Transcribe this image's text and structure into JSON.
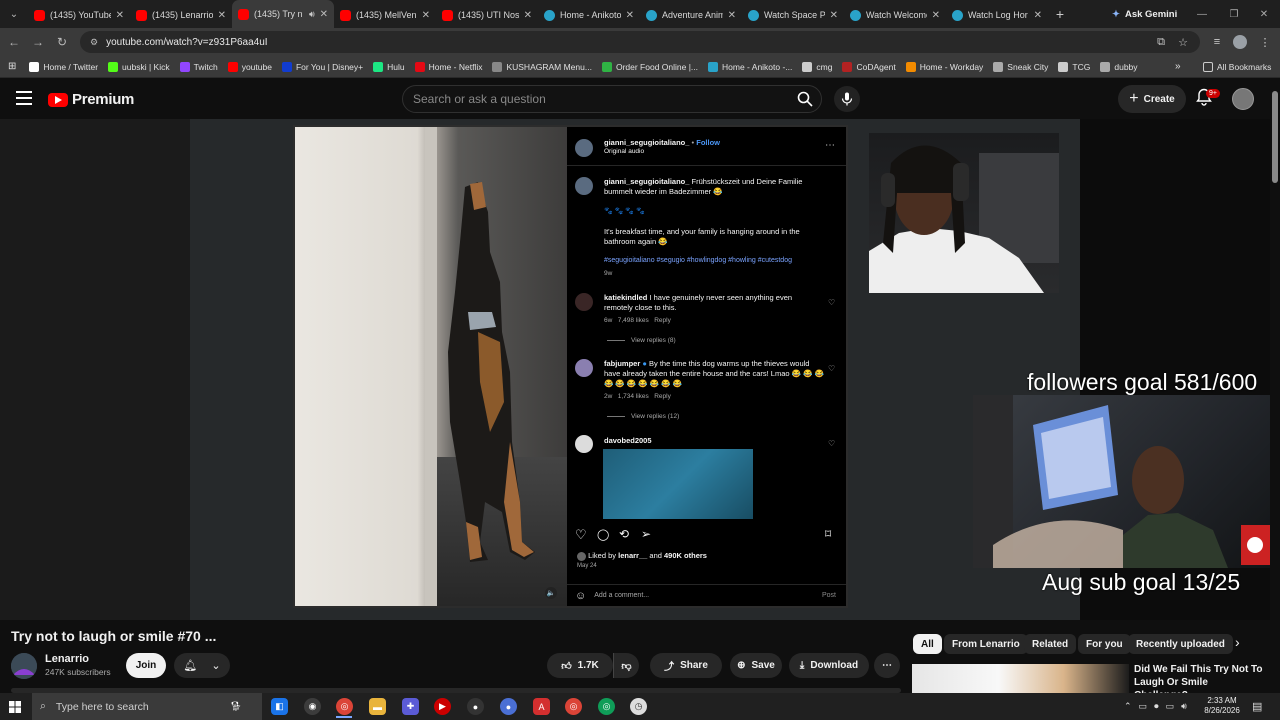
{
  "browser": {
    "tabs": [
      {
        "label": "(1435) YouTube",
        "favicon": "youtube-icon",
        "active": false
      },
      {
        "label": "(1435) Lenarrio",
        "favicon": "youtube-icon",
        "active": false
      },
      {
        "label": "(1435) Try n",
        "favicon": "youtube-icon",
        "active": true
      },
      {
        "label": "(1435) MellVen",
        "favicon": "youtube-icon",
        "active": false
      },
      {
        "label": "(1435) UTI Nos",
        "favicon": "youtube-icon",
        "active": false
      },
      {
        "label": "Home - Anikoto",
        "favicon": "anikoto-icon",
        "active": false
      },
      {
        "label": "Adventure Anim",
        "favicon": "anikoto-icon",
        "active": false
      },
      {
        "label": "Watch Space Pi",
        "favicon": "anikoto-icon",
        "active": false
      },
      {
        "label": "Watch Welcome",
        "favicon": "anikoto-icon",
        "active": false
      },
      {
        "label": "Watch Log Hor",
        "favicon": "anikoto-icon",
        "active": false
      }
    ],
    "ask_gemini": "Ask Gemini",
    "url": "youtube.com/watch?v=z931P6aa4uI",
    "bookmarks": [
      {
        "label": "Home / Twitter",
        "color": "#ffffff"
      },
      {
        "label": "uubski | Kick",
        "color": "#53fc18"
      },
      {
        "label": "Twitch",
        "color": "#9146ff"
      },
      {
        "label": "youtube",
        "color": "#ff0000"
      },
      {
        "label": "For You | Disney+",
        "color": "#113ccf"
      },
      {
        "label": "Hulu",
        "color": "#1ce783"
      },
      {
        "label": "Home - Netflix",
        "color": "#e50914"
      },
      {
        "label": "KUSHAGRAM Menu...",
        "color": "#888888"
      },
      {
        "label": "Order Food Online |...",
        "color": "#2fb344"
      },
      {
        "label": "Home - Anikoto -...",
        "color": "#29a3c9"
      },
      {
        "label": "cmg",
        "color": "#cccccc"
      },
      {
        "label": "CoDAgent",
        "color": "#b22222"
      },
      {
        "label": "Home - Workday",
        "color": "#f38b00"
      },
      {
        "label": "Sneak City",
        "color": "#aaaaaa"
      },
      {
        "label": "TCG",
        "color": "#cccccc"
      },
      {
        "label": "dubby",
        "color": "#aaaaaa"
      }
    ],
    "all_bookmarks": "All Bookmarks"
  },
  "youtube": {
    "logo_text": "Premium",
    "search_placeholder": "Search or ask a question",
    "create_label": "Create",
    "notif_badge": "9+"
  },
  "instagram": {
    "username": "gianni_segugioitaliano_",
    "follow": "Follow",
    "audio": "Original audio",
    "caption_user": "gianni_segugioitaliano_",
    "caption": "Frühstückszeit und Deine Familie bummelt wieder im Badezimmer 😂",
    "emoji_line": "🐾 🐾 🐾 🐾",
    "translation": "It's breakfast time, and your family is hanging around in the bathroom again 😂",
    "hashtags": "#segugioitaliano #segugio #howlingdog #howling #cutestdog",
    "caption_age": "9w",
    "comments": [
      {
        "user": "katiekindled",
        "text": "I have genuinely never seen anything even remotely close to this.",
        "meta": "6w   7,498 likes   Reply",
        "replies": "View replies (8)"
      },
      {
        "user": "fabjumper",
        "text": "By the time this dog warms up the thieves would have already taken the entire house and the cars! Lmao 😂 😂 😂 😂 😂 😂 😂 😂 😂 😂",
        "meta": "2w   1,734 likes   Reply",
        "replies": "View replies (12)"
      },
      {
        "user": "davobed2005",
        "text": "",
        "meta": "",
        "replies": ""
      }
    ],
    "liked_by": "Liked by",
    "liked_user": "lenarr__",
    "liked_and": "and",
    "liked_count": "490K others",
    "date": "May 24",
    "add_comment": "Add a comment...",
    "post": "Post"
  },
  "overlays": {
    "followers_goal": "followers goal 581/600",
    "sub_goal": "Aug sub goal 13/25"
  },
  "video": {
    "title": "Try not to laugh or smile #70 ...",
    "channel": "Lenarrio",
    "subscribers": "247K subscribers",
    "join": "Join",
    "likes": "1.7K",
    "share": "Share",
    "save": "Save",
    "download": "Download"
  },
  "filters": [
    "All",
    "From Lenarrio",
    "Related",
    "For you",
    "Recently uploaded"
  ],
  "recommended": {
    "title": "Did We Fail This Try Not To Laugh Or Smile Challenge?"
  },
  "taskbar": {
    "search_placeholder": "Type here to search",
    "time": "2:33 AM",
    "date": "8/26/2026"
  }
}
